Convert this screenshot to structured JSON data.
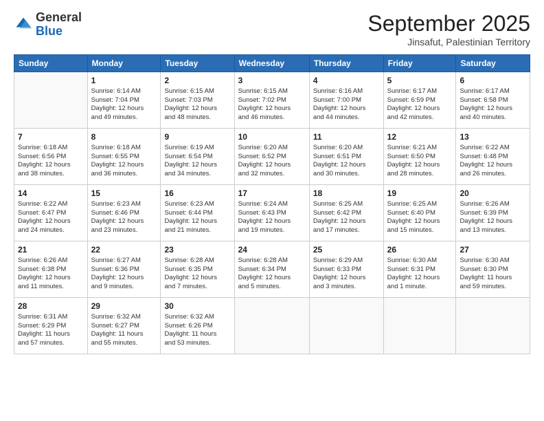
{
  "header": {
    "logo_general": "General",
    "logo_blue": "Blue",
    "month_title": "September 2025",
    "subtitle": "Jinsafut, Palestinian Territory"
  },
  "columns": [
    "Sunday",
    "Monday",
    "Tuesday",
    "Wednesday",
    "Thursday",
    "Friday",
    "Saturday"
  ],
  "weeks": [
    [
      {
        "day": "",
        "info": ""
      },
      {
        "day": "1",
        "info": "Sunrise: 6:14 AM\nSunset: 7:04 PM\nDaylight: 12 hours\nand 49 minutes."
      },
      {
        "day": "2",
        "info": "Sunrise: 6:15 AM\nSunset: 7:03 PM\nDaylight: 12 hours\nand 48 minutes."
      },
      {
        "day": "3",
        "info": "Sunrise: 6:15 AM\nSunset: 7:02 PM\nDaylight: 12 hours\nand 46 minutes."
      },
      {
        "day": "4",
        "info": "Sunrise: 6:16 AM\nSunset: 7:00 PM\nDaylight: 12 hours\nand 44 minutes."
      },
      {
        "day": "5",
        "info": "Sunrise: 6:17 AM\nSunset: 6:59 PM\nDaylight: 12 hours\nand 42 minutes."
      },
      {
        "day": "6",
        "info": "Sunrise: 6:17 AM\nSunset: 6:58 PM\nDaylight: 12 hours\nand 40 minutes."
      }
    ],
    [
      {
        "day": "7",
        "info": "Sunrise: 6:18 AM\nSunset: 6:56 PM\nDaylight: 12 hours\nand 38 minutes."
      },
      {
        "day": "8",
        "info": "Sunrise: 6:18 AM\nSunset: 6:55 PM\nDaylight: 12 hours\nand 36 minutes."
      },
      {
        "day": "9",
        "info": "Sunrise: 6:19 AM\nSunset: 6:54 PM\nDaylight: 12 hours\nand 34 minutes."
      },
      {
        "day": "10",
        "info": "Sunrise: 6:20 AM\nSunset: 6:52 PM\nDaylight: 12 hours\nand 32 minutes."
      },
      {
        "day": "11",
        "info": "Sunrise: 6:20 AM\nSunset: 6:51 PM\nDaylight: 12 hours\nand 30 minutes."
      },
      {
        "day": "12",
        "info": "Sunrise: 6:21 AM\nSunset: 6:50 PM\nDaylight: 12 hours\nand 28 minutes."
      },
      {
        "day": "13",
        "info": "Sunrise: 6:22 AM\nSunset: 6:48 PM\nDaylight: 12 hours\nand 26 minutes."
      }
    ],
    [
      {
        "day": "14",
        "info": "Sunrise: 6:22 AM\nSunset: 6:47 PM\nDaylight: 12 hours\nand 24 minutes."
      },
      {
        "day": "15",
        "info": "Sunrise: 6:23 AM\nSunset: 6:46 PM\nDaylight: 12 hours\nand 23 minutes."
      },
      {
        "day": "16",
        "info": "Sunrise: 6:23 AM\nSunset: 6:44 PM\nDaylight: 12 hours\nand 21 minutes."
      },
      {
        "day": "17",
        "info": "Sunrise: 6:24 AM\nSunset: 6:43 PM\nDaylight: 12 hours\nand 19 minutes."
      },
      {
        "day": "18",
        "info": "Sunrise: 6:25 AM\nSunset: 6:42 PM\nDaylight: 12 hours\nand 17 minutes."
      },
      {
        "day": "19",
        "info": "Sunrise: 6:25 AM\nSunset: 6:40 PM\nDaylight: 12 hours\nand 15 minutes."
      },
      {
        "day": "20",
        "info": "Sunrise: 6:26 AM\nSunset: 6:39 PM\nDaylight: 12 hours\nand 13 minutes."
      }
    ],
    [
      {
        "day": "21",
        "info": "Sunrise: 6:26 AM\nSunset: 6:38 PM\nDaylight: 12 hours\nand 11 minutes."
      },
      {
        "day": "22",
        "info": "Sunrise: 6:27 AM\nSunset: 6:36 PM\nDaylight: 12 hours\nand 9 minutes."
      },
      {
        "day": "23",
        "info": "Sunrise: 6:28 AM\nSunset: 6:35 PM\nDaylight: 12 hours\nand 7 minutes."
      },
      {
        "day": "24",
        "info": "Sunrise: 6:28 AM\nSunset: 6:34 PM\nDaylight: 12 hours\nand 5 minutes."
      },
      {
        "day": "25",
        "info": "Sunrise: 6:29 AM\nSunset: 6:33 PM\nDaylight: 12 hours\nand 3 minutes."
      },
      {
        "day": "26",
        "info": "Sunrise: 6:30 AM\nSunset: 6:31 PM\nDaylight: 12 hours\nand 1 minute."
      },
      {
        "day": "27",
        "info": "Sunrise: 6:30 AM\nSunset: 6:30 PM\nDaylight: 11 hours\nand 59 minutes."
      }
    ],
    [
      {
        "day": "28",
        "info": "Sunrise: 6:31 AM\nSunset: 6:29 PM\nDaylight: 11 hours\nand 57 minutes."
      },
      {
        "day": "29",
        "info": "Sunrise: 6:32 AM\nSunset: 6:27 PM\nDaylight: 11 hours\nand 55 minutes."
      },
      {
        "day": "30",
        "info": "Sunrise: 6:32 AM\nSunset: 6:26 PM\nDaylight: 11 hours\nand 53 minutes."
      },
      {
        "day": "",
        "info": ""
      },
      {
        "day": "",
        "info": ""
      },
      {
        "day": "",
        "info": ""
      },
      {
        "day": "",
        "info": ""
      }
    ]
  ]
}
